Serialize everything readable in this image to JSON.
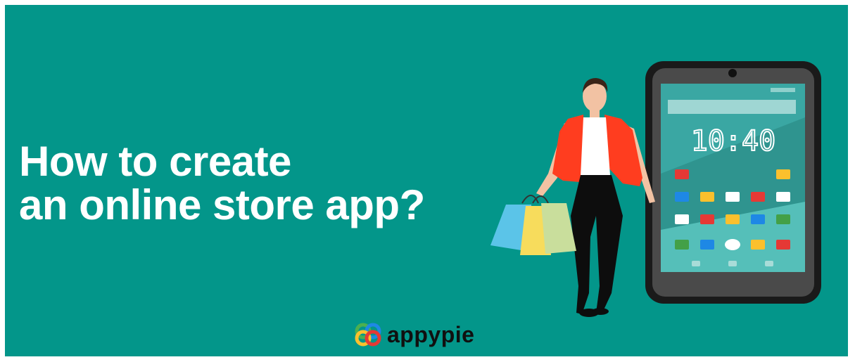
{
  "headline": {
    "line1": "How to create",
    "line2": "an online store app?"
  },
  "phone": {
    "clock": "10:40"
  },
  "brand": {
    "name": "appypie",
    "logo_icon": "appypie-logo-icon"
  },
  "colors": {
    "background": "#03968a",
    "headline_text": "#ffffff",
    "phone_screen": "#3ab0a8",
    "jacket": "#ff3d1f",
    "bag_blue": "#5bc4e8",
    "bag_yellow": "#f7dc5c",
    "bag_green": "#c9de9c"
  }
}
